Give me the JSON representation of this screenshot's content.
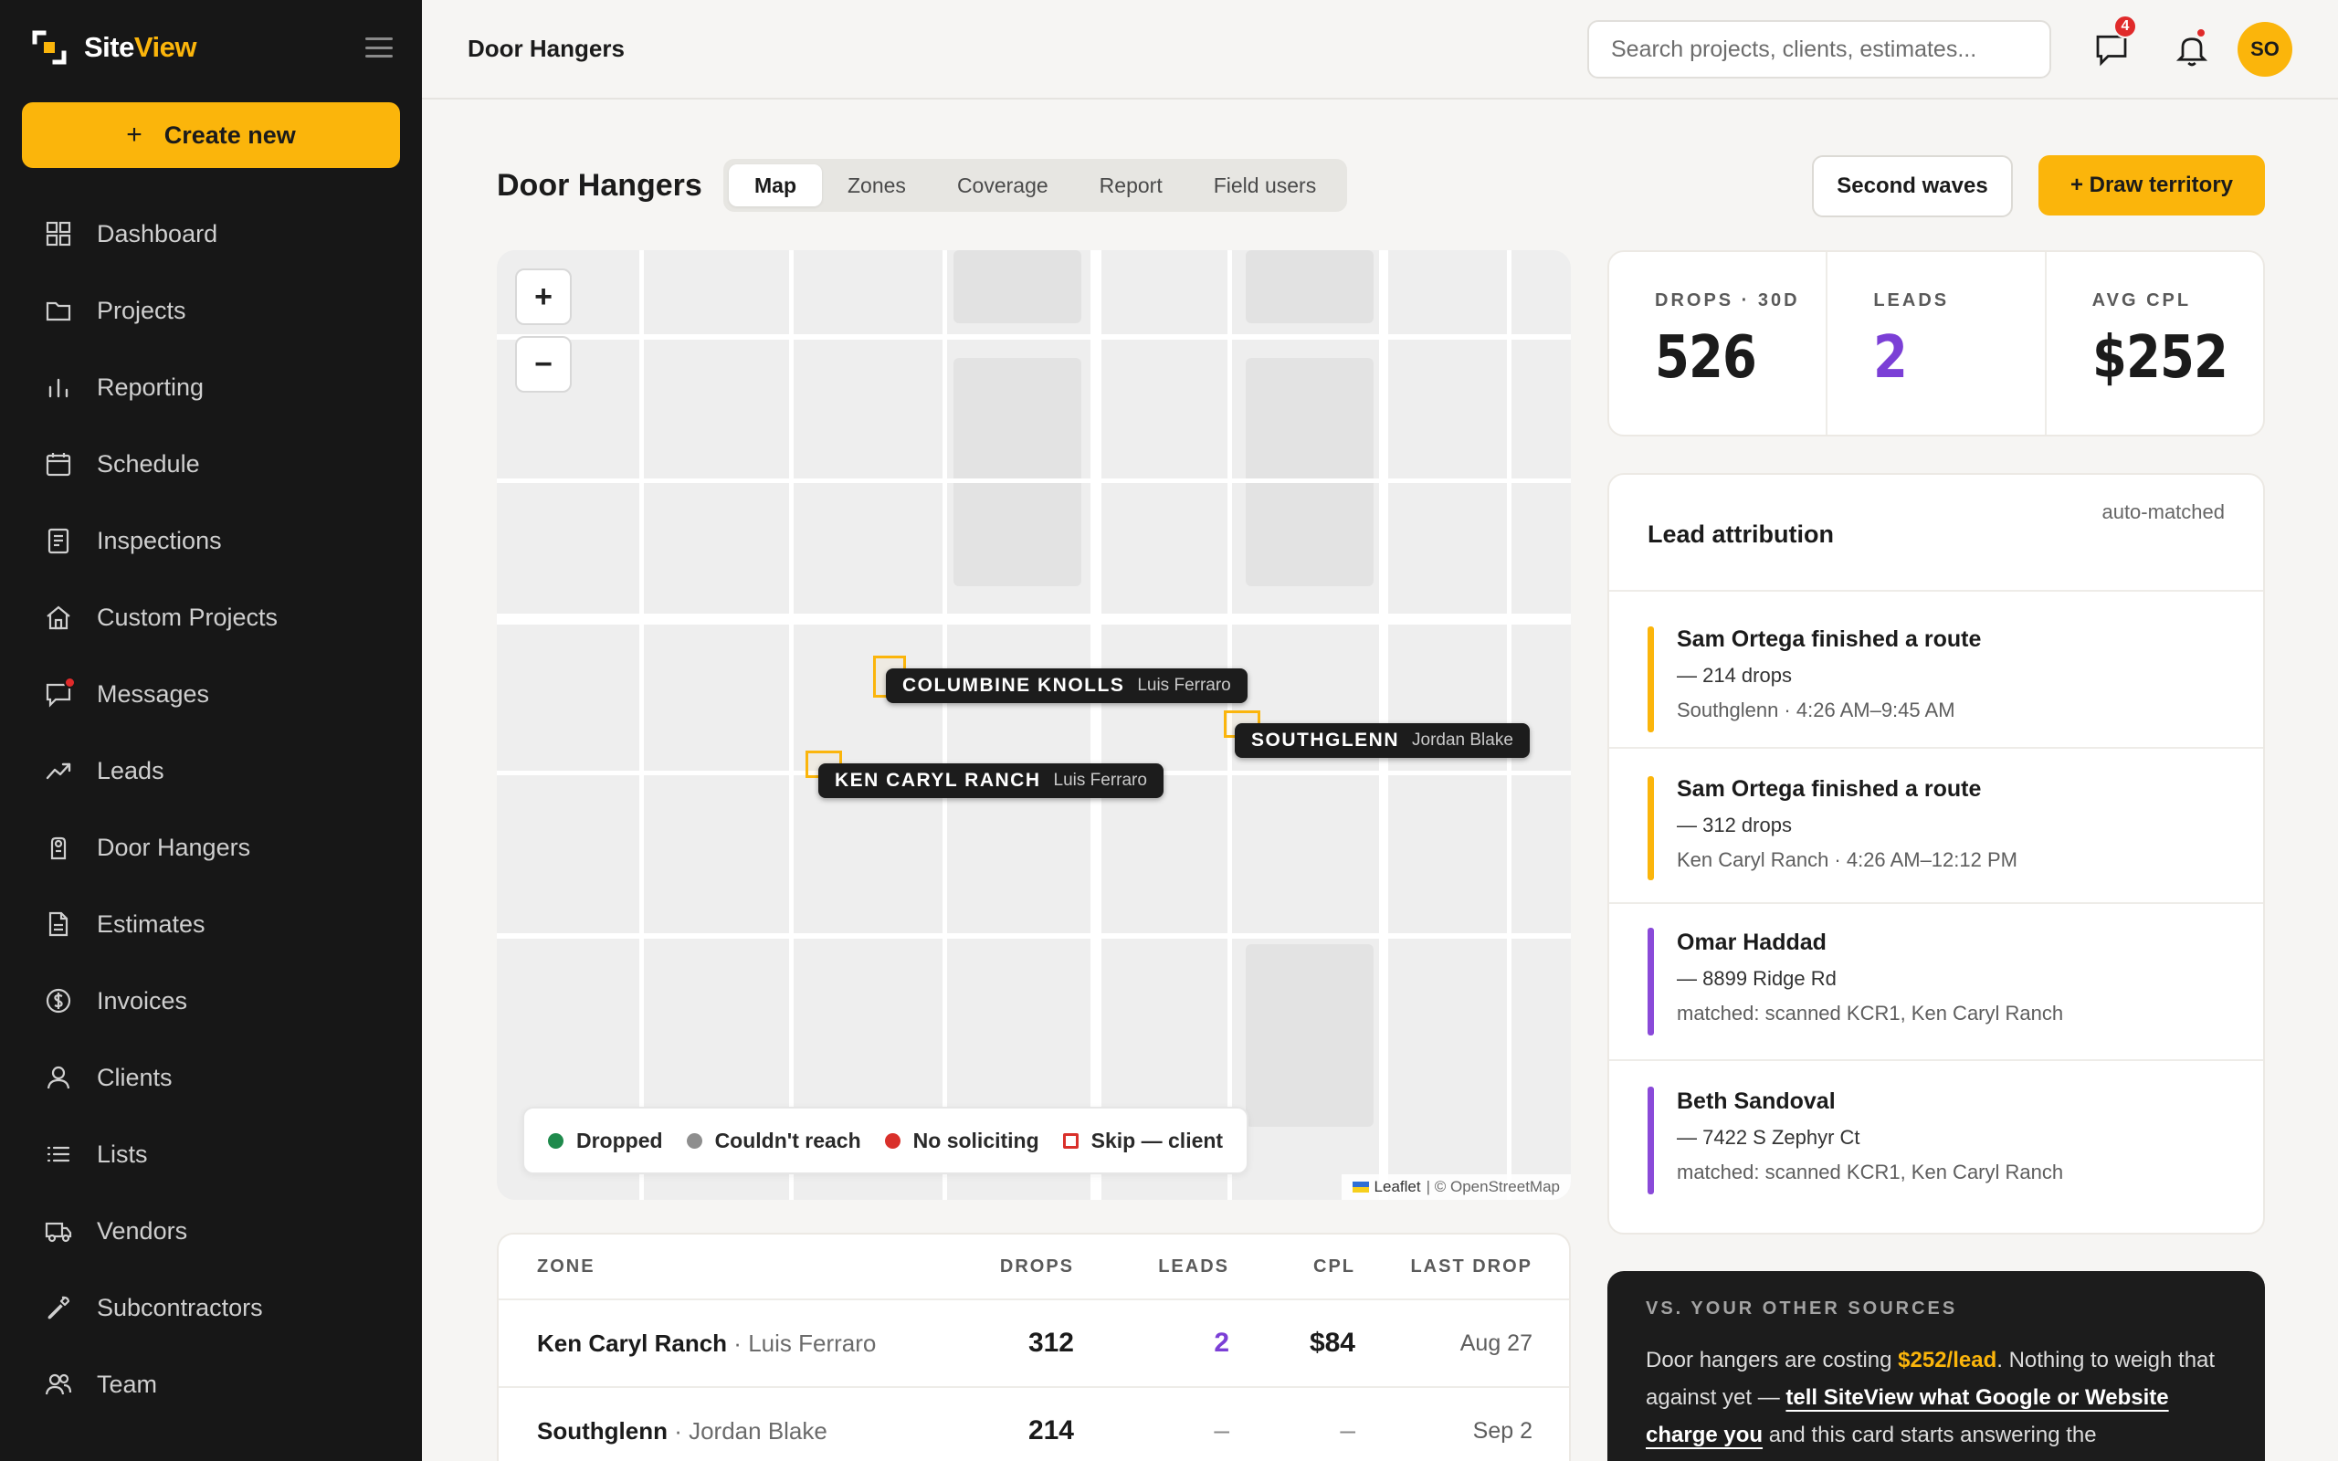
{
  "app": {
    "brand_prefix": "Site",
    "brand_suffix": "View",
    "brand_color": "#fbb50b"
  },
  "sidebar": {
    "create_label": "Create new",
    "create_icon": "plus-icon",
    "items": [
      {
        "label": "Dashboard",
        "icon": "dashboard-icon"
      },
      {
        "label": "Projects",
        "icon": "folder-icon"
      },
      {
        "label": "Reporting",
        "icon": "bar-chart-icon"
      },
      {
        "label": "Schedule",
        "icon": "calendar-icon"
      },
      {
        "label": "Inspections",
        "icon": "clipboard-icon"
      },
      {
        "label": "Custom Projects",
        "icon": "home-icon"
      },
      {
        "label": "Messages",
        "icon": "message-icon",
        "has_notification": true
      },
      {
        "label": "Leads",
        "icon": "trending-up-icon"
      },
      {
        "label": "Door Hangers",
        "icon": "door-hanger-icon"
      },
      {
        "label": "Estimates",
        "icon": "document-icon"
      },
      {
        "label": "Invoices",
        "icon": "dollar-icon"
      },
      {
        "label": "Clients",
        "icon": "user-icon"
      },
      {
        "label": "Lists",
        "icon": "list-icon"
      },
      {
        "label": "Vendors",
        "icon": "truck-icon"
      },
      {
        "label": "Subcontractors",
        "icon": "wrench-icon"
      },
      {
        "label": "Team",
        "icon": "team-icon"
      }
    ]
  },
  "topbar": {
    "title": "Door Hangers",
    "search_placeholder": "Search projects, clients, estimates...",
    "messages_count": "4",
    "avatar_initials": "SO"
  },
  "page": {
    "title": "Door Hangers",
    "tabs": [
      {
        "label": "Map",
        "active": true
      },
      {
        "label": "Zones",
        "active": false
      },
      {
        "label": "Coverage",
        "active": false
      },
      {
        "label": "Report",
        "active": false
      },
      {
        "label": "Field users",
        "active": false
      }
    ],
    "secondary_button": "Second waves",
    "primary_button": "+ Draw territory"
  },
  "map": {
    "zoom_in": "+",
    "zoom_out": "−",
    "zones": [
      {
        "name": "COLUMBINE KNOLLS",
        "user": "Luis Ferraro"
      },
      {
        "name": "SOUTHGLENN",
        "user": "Jordan Blake"
      },
      {
        "name": "KEN CARYL RANCH",
        "user": "Luis Ferraro"
      }
    ],
    "legend": [
      {
        "label": "Dropped",
        "color": "#1f8a4c",
        "shape": "dot"
      },
      {
        "label": "Couldn't reach",
        "color": "#8e8e8e",
        "shape": "dot"
      },
      {
        "label": "No soliciting",
        "color": "#d9302b",
        "shape": "dot"
      },
      {
        "label": "Skip — client",
        "color": "#d9302b",
        "shape": "square"
      }
    ],
    "attribution_link": "Leaflet",
    "attribution_text": "| © OpenStreetMap"
  },
  "table": {
    "headers": {
      "zone": "ZONE",
      "drops": "DROPS",
      "leads": "LEADS",
      "cpl": "CPL",
      "last": "LAST DROP"
    },
    "rows": [
      {
        "zone": "Ken Caryl Ranch",
        "user": "Luis Ferraro",
        "drops": "312",
        "leads": "2",
        "cpl": "$84",
        "last": "Aug 27"
      },
      {
        "zone": "Southglenn",
        "user": "Jordan Blake",
        "drops": "214",
        "leads": "–",
        "cpl": "–",
        "last": "Sep 2"
      }
    ]
  },
  "stats": [
    {
      "label": "DROPS · 30D",
      "value": "526"
    },
    {
      "label": "LEADS",
      "value": "2"
    },
    {
      "label": "AVG CPL",
      "value": "$252"
    }
  ],
  "attribution": {
    "title": "Lead attribution",
    "note": "auto-matched",
    "items": [
      {
        "title": "Sam Ortega finished a route",
        "detail": "— 214 drops",
        "meta": "Southglenn · 4:26 AM–9:45 AM",
        "color": "#fbb50b"
      },
      {
        "title": "Sam Ortega finished a route",
        "detail": "— 312 drops",
        "meta": "Ken Caryl Ranch · 4:26 AM–12:12 PM",
        "color": "#fbb50b"
      },
      {
        "title": "Omar Haddad",
        "detail": "— 8899 Ridge Rd",
        "meta": "matched: scanned KCR1, Ken Caryl Ranch",
        "color": "#8a4ad9"
      },
      {
        "title": "Beth Sandoval",
        "detail": "— 7422 S Zephyr Ct",
        "meta": "matched: scanned KCR1, Ken Caryl Ranch",
        "color": "#8a4ad9"
      }
    ]
  },
  "sources_card": {
    "label": "VS. YOUR OTHER SOURCES",
    "text_1": "Door hangers are costing ",
    "highlight": "$252/lead",
    "text_2": ". Nothing to weigh that against yet — ",
    "link": "tell SiteView what Google or Website charge you",
    "text_3": " and this card starts answering the"
  }
}
